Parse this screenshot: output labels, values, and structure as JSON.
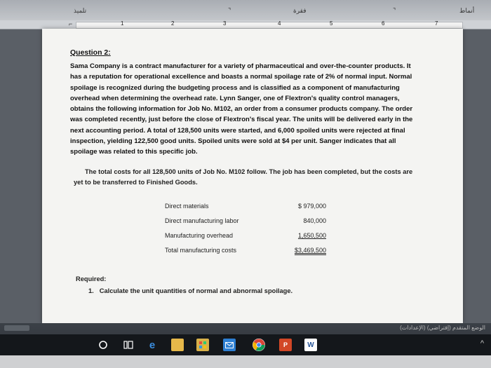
{
  "ribbon": {
    "label_left": "تلميذ",
    "label_center": "فقرة",
    "label_right": "أنماط"
  },
  "ruler": {
    "marks": [
      "1",
      "2",
      "3",
      "4",
      "5",
      "6",
      "7"
    ]
  },
  "document": {
    "question_title": "Question 2:",
    "paragraph1": "Sama Company is a contract manufacturer for a variety of pharmaceutical and over-the-counter products. It has a reputation for operational excellence and boasts a normal spoilage rate of 2% of normal input. Normal spoilage is recognized during the budgeting process and is classified as a component of manufacturing overhead when determining the overhead rate. Lynn Sanger, one of Flextron's quality control managers, obtains the following information for Job No. M102, an order from a consumer products company. The order was completed recently, just before the close of Flextron's fiscal year. The units will be delivered early in the next accounting period. A total of 128,500 units were started, and 6,000 spoiled units were rejected at final inspection, yielding 122,500 good units. Spoiled units were sold at $4 per unit. Sanger indicates that all spoilage was related to this specific job.",
    "paragraph2": "The total costs for all 128,500 units of Job No. M102 follow. The job has been completed, but the costs are yet to be transferred to Finished Goods.",
    "costs": [
      {
        "item": "Direct materials",
        "amount": "$ 979,000"
      },
      {
        "item": "Direct manufacturing labor",
        "amount": "840,000"
      },
      {
        "item": "Manufacturing overhead",
        "amount": "1,650,500"
      },
      {
        "item": "Total manufacturing costs",
        "amount": "$3,469,500"
      }
    ],
    "required_label": "Required:",
    "required_items": [
      {
        "number": "1.",
        "text": "Calculate the unit quantities of normal and abnormal spoilage."
      }
    ]
  },
  "status": {
    "text": "(الإعدادات) الوضع المتقدم (إفتراضي)"
  },
  "taskbar": {
    "icons": [
      "search-icon",
      "task-view-icon",
      "edge-icon",
      "file-explorer-icon",
      "store-icon",
      "mail-icon",
      "chrome-icon",
      "powerpoint-icon",
      "word-icon"
    ]
  }
}
